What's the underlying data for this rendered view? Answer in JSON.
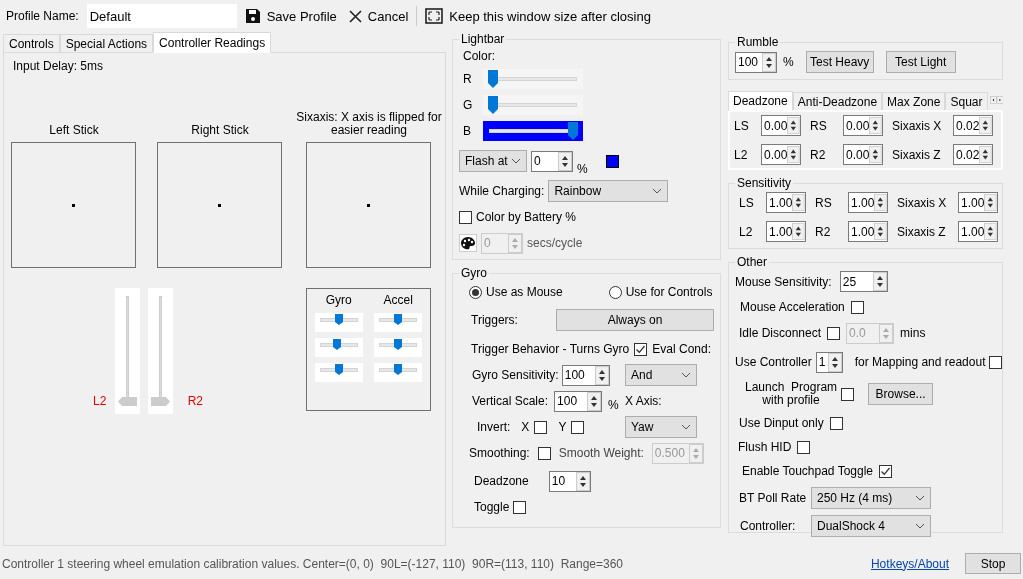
{
  "toolbar": {
    "profile_label": "Profile Name:",
    "profile_name": "Default",
    "buttons": [
      {
        "kind": "save",
        "label": "Save Profile"
      },
      {
        "kind": "cancel",
        "label": "Cancel"
      },
      {
        "kind": "keep",
        "label": "Keep this window size after closing"
      }
    ]
  },
  "tabs": [
    {
      "label": "Controls",
      "selected": false
    },
    {
      "label": "Special Actions",
      "selected": false
    },
    {
      "label": "Controller Readings",
      "selected": true
    }
  ],
  "readings": {
    "input_delay": "Input Delay: 5ms",
    "sticks": [
      {
        "title": "Left Stick"
      },
      {
        "title": "Right Stick"
      },
      {
        "title": "Sixaxis: X axis is flipped for easier reading"
      }
    ],
    "triggers": [
      {
        "label": "L2",
        "level": 0
      },
      {
        "label": "R2",
        "level": 0
      }
    ],
    "motion": {
      "columns": [
        {
          "title": "Gyro",
          "sliders": [
            {
              "level": 0.5
            },
            {
              "level": 0.45
            },
            {
              "level": 0.5
            }
          ]
        },
        {
          "title": "Accel",
          "sliders": [
            {
              "level": 0.5
            },
            {
              "level": 0.5
            },
            {
              "level": 0.5
            }
          ]
        }
      ]
    }
  },
  "lightbar": {
    "title": "Lightbar",
    "color_label": "Color:",
    "channels": [
      {
        "label": "R",
        "level": 0
      },
      {
        "label": "G",
        "level": 0
      },
      {
        "label": "B",
        "level": 1
      }
    ],
    "flash": {
      "mode": "Flash at",
      "value": "0",
      "unit": "%"
    },
    "while_charging": {
      "label": "While Charging:",
      "value": "Rainbow"
    },
    "color_by_battery": {
      "label": "Color by Battery %",
      "checked": false
    },
    "rainbow": {
      "value": "0",
      "unit": "secs/cycle",
      "disabled": true
    }
  },
  "gyro": {
    "title": "Gyro",
    "modes": [
      {
        "label": "Use as Mouse",
        "selected": true
      },
      {
        "label": "Use for Controls",
        "selected": false
      }
    ],
    "triggers": {
      "label": "Triggers:",
      "value": "Always on"
    },
    "trigger_behavior": {
      "label": "Trigger Behavior - Turns Gyro",
      "checked": true
    },
    "eval_cond": {
      "label": "Eval Cond:",
      "value": "And"
    },
    "sensitivity": {
      "label": "Gyro Sensitivity:",
      "value": "100"
    },
    "vertical_scale": {
      "label": "Vertical Scale:",
      "value": "100",
      "unit": "%"
    },
    "x_axis": {
      "label": "X Axis:",
      "value": "Yaw"
    },
    "invert": {
      "label": "Invert:",
      "axes": [
        {
          "label": "X",
          "checked": false
        },
        {
          "label": "Y",
          "checked": false
        }
      ]
    },
    "smoothing": {
      "label": "Smoothing:",
      "checked": false
    },
    "smooth_weight": {
      "label": "Smooth Weight:",
      "value": "0.500",
      "disabled": true
    },
    "deadzone": {
      "label": "Deadzone",
      "value": "10"
    },
    "toggle": {
      "label": "Toggle",
      "checked": false
    }
  },
  "rumble": {
    "title": "Rumble",
    "value": "100",
    "unit": "%",
    "buttons": [
      "Test Heavy",
      "Test Light"
    ]
  },
  "zone_tabs": [
    {
      "label": "Deadzone",
      "selected": true
    },
    {
      "label": "Anti-Deadzone",
      "selected": false
    },
    {
      "label": "Max Zone",
      "selected": false
    },
    {
      "label": "Squar",
      "selected": false
    }
  ],
  "zone_fields": [
    {
      "label": "LS",
      "value": "0.00"
    },
    {
      "label": "RS",
      "value": "0.00"
    },
    {
      "label": "Sixaxis X",
      "value": "0.02"
    },
    {
      "label": "L2",
      "value": "0.00"
    },
    {
      "label": "R2",
      "value": "0.00"
    },
    {
      "label": "Sixaxis Z",
      "value": "0.02"
    }
  ],
  "sensitivity": {
    "title": "Sensitivity",
    "fields": [
      {
        "label": "LS",
        "value": "1.00"
      },
      {
        "label": "RS",
        "value": "1.00"
      },
      {
        "label": "Sixaxis X",
        "value": "1.00"
      },
      {
        "label": "L2",
        "value": "1.00"
      },
      {
        "label": "R2",
        "value": "1.00"
      },
      {
        "label": "Sixaxis Z",
        "value": "1.00"
      }
    ]
  },
  "other": {
    "title": "Other",
    "mouse_sensitivity": {
      "label": "Mouse Sensitivity:",
      "value": "25"
    },
    "mouse_acceleration": {
      "label": "Mouse Acceleration",
      "checked": false
    },
    "idle_disconnect": {
      "label": "Idle Disconnect",
      "checked": false,
      "value": "0.0",
      "unit": "mins",
      "disabled": true
    },
    "use_controller": {
      "label": "Use Controller",
      "value": "1",
      "suffix": "for Mapping and readout",
      "checked": false
    },
    "launch_program": {
      "label": "Launch  Program\nwith profile",
      "checked": false,
      "button": "Browse..."
    },
    "use_dinput": {
      "label": "Use Dinput only",
      "checked": false
    },
    "flush_hid": {
      "label": "Flush HID",
      "checked": false
    },
    "touchpad_toggle": {
      "label": "Enable Touchpad Toggle",
      "checked": true
    },
    "bt_poll_rate": {
      "label": "BT Poll Rate",
      "value": "250 Hz (4 ms)"
    },
    "controller": {
      "label": "Controller:",
      "value": "DualShock 4"
    }
  },
  "status_bar": {
    "message": "Controller 1 steering wheel emulation calibration values. Center=(0, 0)  90L=(-127, 110)  90R=(113, 110)  Range=360",
    "link": "Hotkeys/About",
    "button": "Stop"
  }
}
